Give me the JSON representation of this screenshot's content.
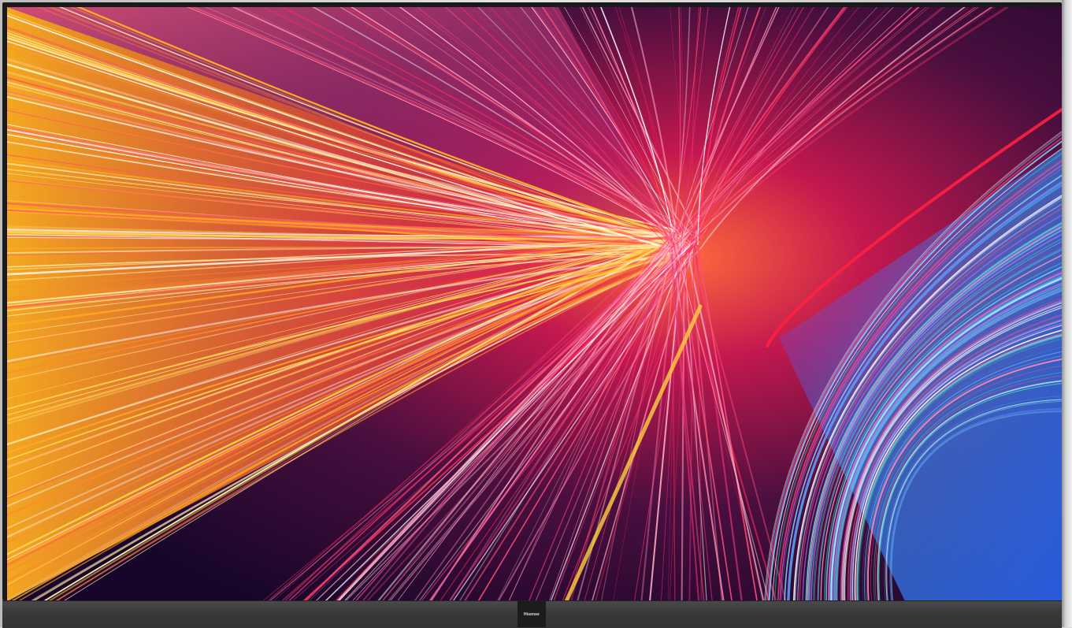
{
  "device": {
    "brand_logo": "Hisense"
  },
  "screen": {
    "content": "abstract-light-streaks-wallpaper"
  },
  "colors": {
    "bezel": "#1a1a1a",
    "soundbar": "#3a3a3a",
    "background_frame": "#d9d9d9"
  }
}
